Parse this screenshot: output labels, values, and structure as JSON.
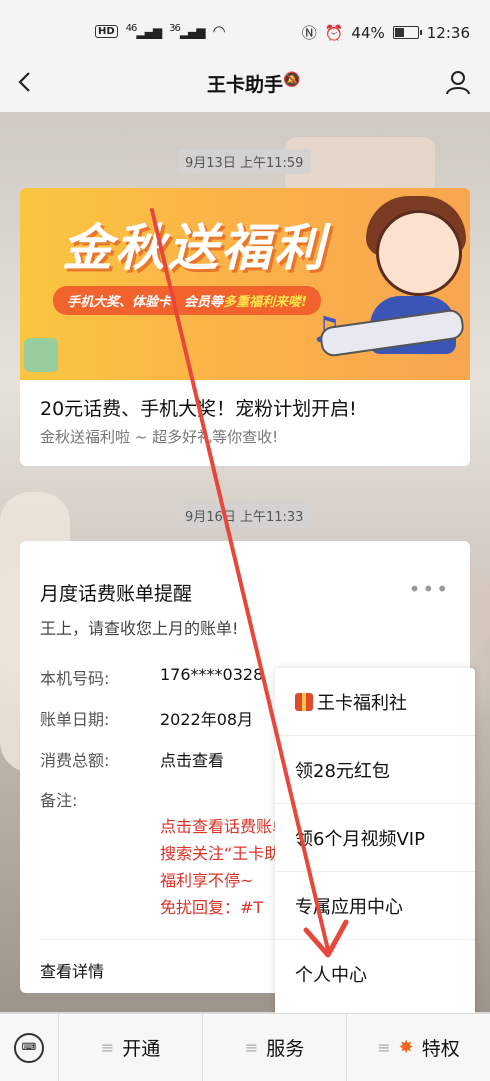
{
  "status": {
    "time": "12:36",
    "battery": "44%",
    "signal1": "46",
    "signal2": "36",
    "hd": "HD"
  },
  "header": {
    "title": "王卡助手"
  },
  "messages": [
    {
      "timestamp": "9月13日 上午11:59",
      "banner_title": "金秋送福利",
      "banner_tag_prefix": "手机大奖、体验卡、会员等",
      "banner_tag_highlight": "多重福利来喽!",
      "title": "20元话费、手机大奖！宠粉计划开启!",
      "subtitle": "金秋送福利啦 ~ 超多好礼等你查收!"
    },
    {
      "timestamp": "9月16日 上午11:33",
      "title": "月度话费账单提醒",
      "greeting": "王上，请查收您上月的账单!",
      "rows": [
        {
          "label": "本机号码:",
          "value": "176****0328"
        },
        {
          "label": "账单日期:",
          "value": "2022年08月"
        },
        {
          "label": "消费总额:",
          "value": "点击查看"
        },
        {
          "label": "备注:",
          "value": ""
        }
      ],
      "remarks": [
        "点击查看话费账单",
        "搜索关注“王卡助手”",
        "福利享不停~",
        "免扰回复：#T"
      ],
      "detail_link": "查看详情"
    }
  ],
  "menu": {
    "items": [
      "王卡福利社",
      "领28元红包",
      "领6个月视频VIP",
      "专属应用中心",
      "个人中心"
    ]
  },
  "bottom_tabs": [
    "开通",
    "服务",
    "特权"
  ]
}
